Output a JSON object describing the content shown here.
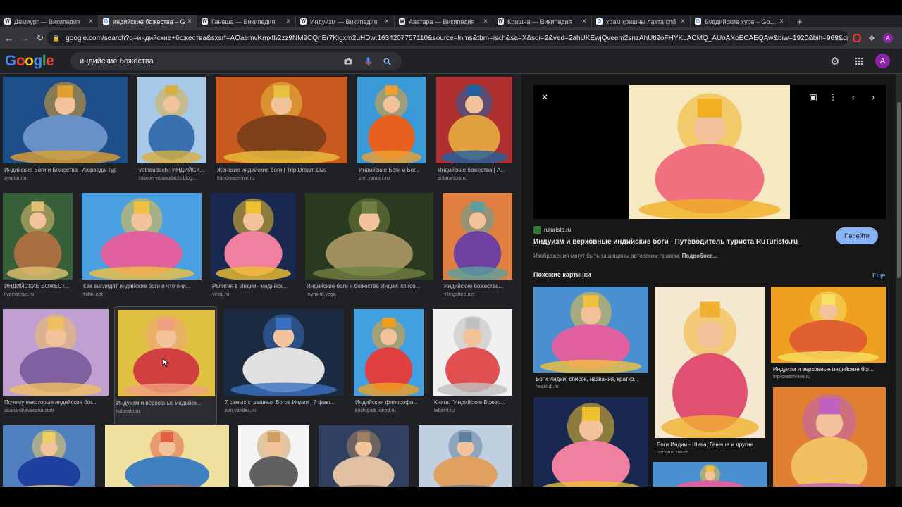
{
  "browser": {
    "tabs": [
      {
        "label": "Демиург — Википедия",
        "icon": "W"
      },
      {
        "label": "индийские божества – G",
        "icon": "G",
        "active": true
      },
      {
        "label": "Ганеша — Википедия",
        "icon": "W"
      },
      {
        "label": "Индуизм — Википедия",
        "icon": "W"
      },
      {
        "label": "Аватара — Википедия",
        "icon": "W"
      },
      {
        "label": "Кришна — Википедия",
        "icon": "W"
      },
      {
        "label": "храм кришны лахта спб",
        "icon": "G"
      },
      {
        "label": "Буддийские хуре – Google",
        "icon": "G"
      }
    ],
    "new_tab": "+",
    "url": "google.com/search?q=индийские+божества&sxsrf=AOaemvKmxfb2zz9NM9CQnEr7Klgxm2uHDw:1634207757110&source=lnms&tbm=isch&sa=X&sqi=2&ved=2ahUKEwjQveem2snzAhUtl2oFHYKLACMQ_AUoAXoECAEQAw&biw=1920&bih=969&dpr=1#i..."
  },
  "google": {
    "logo": [
      "G",
      "o",
      "o",
      "g",
      "l",
      "e"
    ],
    "logo_colors": [
      "#4285f4",
      "#ea4335",
      "#fbbc05",
      "#4285f4",
      "#34a853",
      "#ea4335"
    ],
    "query": "индийские божества",
    "avatar_letter": "A"
  },
  "results": [
    {
      "caption": "Индийские Боги и Божества | Аюрведа-Тур",
      "source": "ayurtour.ru",
      "palette": [
        "#1d4e8a",
        "#e0a030",
        "#6a90c8"
      ]
    },
    {
      "caption": "volnaudachi: ИНДИЙСКИЕ...",
      "source": "roscoe-volnaudachi.blog...",
      "palette": [
        "#a8c8e8",
        "#d8b040",
        "#3a70b0"
      ]
    },
    {
      "caption": "Женские индийские боги | Trip.Dream.Live",
      "source": "trip-dream-live.ru",
      "palette": [
        "#c85a20",
        "#e8c040",
        "#80401a"
      ]
    },
    {
      "caption": "Индийские Боги и Бог...",
      "source": "zen.yandex.ru",
      "palette": [
        "#3a9ad8",
        "#f0a030",
        "#e86020"
      ]
    },
    {
      "caption": "Индийские божества | А...",
      "source": "antara-tour.ru",
      "palette": [
        "#b03030",
        "#2060a0",
        "#e0a040"
      ]
    },
    {
      "caption": "ИНДИЙСКИЕ БОЖЕСТ...",
      "source": "liveinternet.ru",
      "palette": [
        "#386038",
        "#e0c070",
        "#a87040"
      ]
    },
    {
      "caption": "Как выглядят индийские боги и что они...",
      "source": "fishki.net",
      "palette": [
        "#4aa0e0",
        "#f0c040",
        "#e060a0"
      ]
    },
    {
      "caption": "Религия в Индии - индийск...",
      "source": "vindii.ru",
      "palette": [
        "#182850",
        "#f0c030",
        "#f080a0"
      ]
    },
    {
      "caption": "Индийские боги и божества Индии: списо...",
      "source": "mymind.yoga",
      "palette": [
        "#2a3a20",
        "#708040",
        "#a09060"
      ]
    },
    {
      "caption": "Индийские божества...",
      "source": "vilingstore.net",
      "palette": [
        "#e08040",
        "#5aa0a0",
        "#7040a0"
      ]
    },
    {
      "caption": "Почему некоторые индийские бог...",
      "source": "asana-shavasana.com",
      "palette": [
        "#c0a0d0",
        "#f0c060",
        "#8060a0"
      ]
    },
    {
      "caption": "Индуизм и верховные индийск...",
      "source": "ruturisto.ru",
      "palette": [
        "#e0c040",
        "#f0a080",
        "#d04040"
      ],
      "selected": true
    },
    {
      "caption": "7 самых страшных Богов Индии | 7 факт...",
      "source": "zen.yandex.ru",
      "palette": [
        "#1a2a40",
        "#3a70c0",
        "#e0e0e0"
      ]
    },
    {
      "caption": "Индийская философи...",
      "source": "kuchipudi.narod.ru",
      "palette": [
        "#40a0e0",
        "#f0a020",
        "#e04040"
      ]
    },
    {
      "caption": "Книга: \"Индийские Божес...",
      "source": "labirint.ru",
      "palette": [
        "#f0f0f0",
        "#c0c0c0",
        "#e05050"
      ]
    },
    {
      "caption": "",
      "source": "",
      "palette": [
        "#5080c0",
        "#f0d060",
        "#2040a0"
      ]
    },
    {
      "caption": "",
      "source": "",
      "palette": [
        "#f0e0a0",
        "#e06040",
        "#4080c0"
      ]
    },
    {
      "caption": "",
      "source": "",
      "palette": [
        "#f4f4f4",
        "#d0a060",
        "#606060"
      ]
    },
    {
      "caption": "",
      "source": "",
      "palette": [
        "#304060",
        "#a08060",
        "#e0c0a0"
      ]
    },
    {
      "caption": "",
      "source": "",
      "palette": [
        "#c0d0e0",
        "#6080a0",
        "#e0a060"
      ]
    }
  ],
  "preview": {
    "palette": [
      "#f6e8c0",
      "#f0b020",
      "#f07080"
    ],
    "site": "ruturisto.ru",
    "title": "Индуизм и верховные индийские боги - Путеводитель туриста RuTuristo.ru",
    "visit_label": "Перейти",
    "copyright": "Изображения могут быть защищены авторским правом.",
    "copyright_more": "Подробнее...",
    "related_heading": "Похожие картинки",
    "related_more": "Ещё",
    "related": [
      {
        "caption": "Боги Индии: список, названия, кратко...",
        "source": "heaclub.ru",
        "palette": [
          "#4a90d0",
          "#f0c040",
          "#e060a0"
        ]
      },
      {
        "caption": "Боги Индии - Шива, Ганеша и другие",
        "source": "nervana.name",
        "palette": [
          "#f4e8d0",
          "#f0b030",
          "#e05070"
        ]
      },
      {
        "caption": "Индуизм и верховные индийские бог...",
        "source": "trip-dream-live.ru",
        "palette": [
          "#f0a020",
          "#f8e060",
          "#e06030"
        ]
      },
      {
        "caption": "",
        "source": "",
        "palette": [
          "#182850",
          "#f0c030",
          "#f080a0"
        ]
      },
      {
        "caption": "",
        "source": "",
        "palette": [
          "#4a90d0",
          "#f0c040",
          "#e060a0"
        ]
      },
      {
        "caption": "",
        "source": "",
        "palette": [
          "#e08030",
          "#c060c0",
          "#f0c060"
        ]
      }
    ]
  }
}
